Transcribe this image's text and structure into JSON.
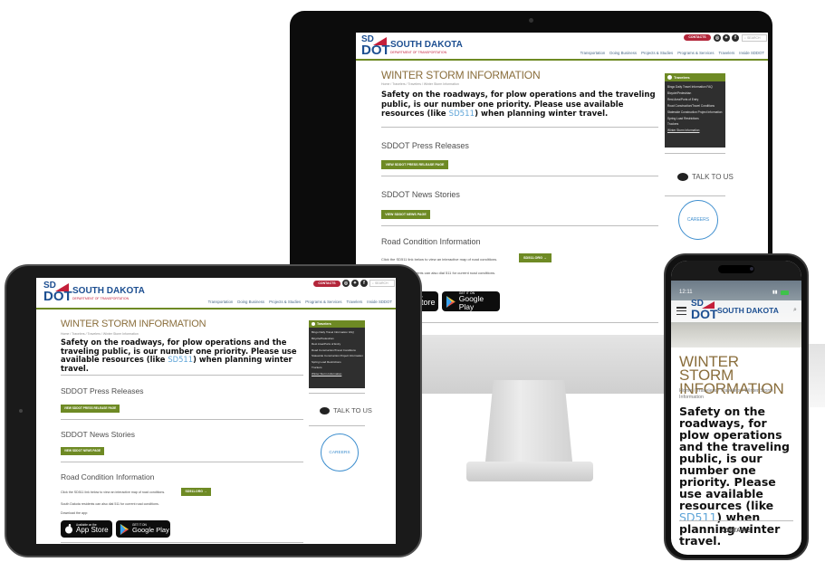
{
  "site": {
    "logo_sd": "SD",
    "logo_dot": "DOT",
    "logo_name": "SOUTH DAKOTA",
    "logo_sub": "DEPARTMENT OF TRANSPORTATION",
    "contacts": "CONTACTS",
    "search_placeholder": "SEARCH",
    "nav": [
      "Transportation",
      "Doing Business",
      "Projects & Studies",
      "Programs & Services",
      "Travelers",
      "Inside SDDOT"
    ]
  },
  "page": {
    "title": "WINTER STORM INFORMATION",
    "breadcrumb": "Home / Travelers / Travelers / Winter Storm Information",
    "lead_before": "Safety on the roadways, for plow operations and the traveling public, is our number one priority. Please use available resources (like ",
    "lead_link": "SD511",
    "lead_after": ") when planning winter travel.",
    "press_heading": "SDDOT Press Releases",
    "press_button": "VIEW SDDOT PRESS RELEASE PAGE",
    "news_heading": "SDDOT News Stories",
    "news_button": "VIEW SDDOT NEWS PAGE",
    "road_heading": "Road Condition Information",
    "road_text": "Click the SD511 link below to view an interactive map of road conditions.",
    "road_button": "SD511.ORG →",
    "dial_text": "South Dakota residents can also dial 511 for current road conditions.",
    "download_text": "Download the app:",
    "appstore_small": "Available on the",
    "appstore_big": "App Store",
    "gplay_small": "GET IT ON",
    "gplay_big": "Google Play"
  },
  "sidebar": {
    "heading": "Travelers",
    "items": [
      "Bingo Daily Travel Information FAQ",
      "Bicycle/Pedestrian",
      "Rest Area/Ports of Entry",
      "Road Construction/Travel Conditions",
      "Statewide Construction Project Information",
      "Spring Load Restrictions",
      "Truckers",
      "Winter Storm Information"
    ],
    "talk": "TALK TO US",
    "careers": "CAREERS"
  },
  "desktop_fragments": {
    "dial_partial": "ents can also dial 511 for current road conditions.",
    "appstore_partial": "n the",
    "store_partial": "Store"
  },
  "phone": {
    "time": "12:11",
    "status_icons": "signal-icon wifi-icon battery-icon",
    "breadcrumb": "Home / Travelers / Travelers / Winter Storm Information",
    "footer": "CONTACTS"
  },
  "colors": {
    "brand_blue": "#1d4f91",
    "brand_red": "#c41f3a",
    "accent_green": "#6e8a24",
    "title_brown": "#8a6e3c",
    "link_blue": "#5fa5d8"
  }
}
